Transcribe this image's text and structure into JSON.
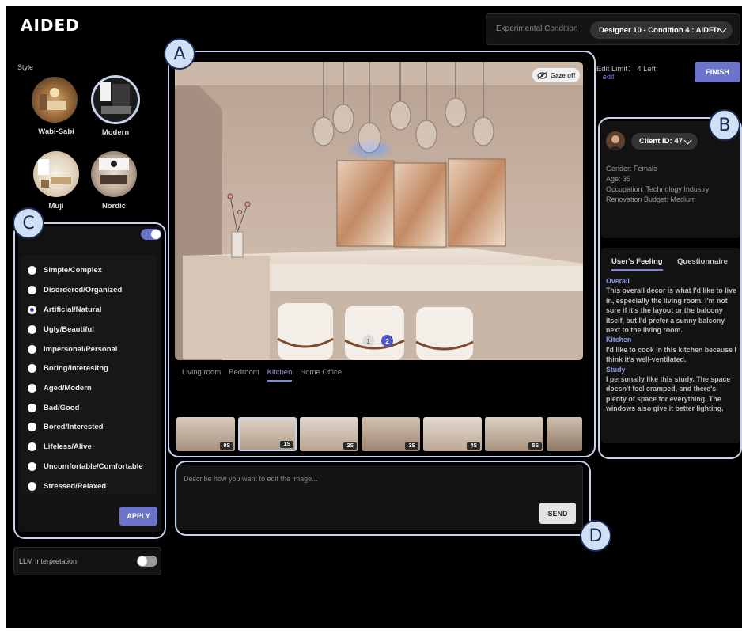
{
  "app": {
    "title": "AIDED"
  },
  "experiment": {
    "label": "Experimental Condition",
    "selected": "Designer 10 - Condition 4 : AIDED"
  },
  "styles": {
    "label": "Style",
    "items": [
      {
        "name": "Wabi-Sabi"
      },
      {
        "name": "Modern"
      },
      {
        "name": "Muji"
      },
      {
        "name": "Nordic"
      }
    ]
  },
  "criteria": {
    "items": [
      "Simple/Complex",
      "Disordered/Organized",
      "Artificial/Natural",
      "Ugly/Beautiful",
      "Impersonal/Personal",
      "Boring/Interesitng",
      "Aged/Modern",
      "Bad/Good",
      "Bored/Interested",
      "Lifeless/Alive",
      "Uncomfortable/Comfortable",
      "Stressed/Relaxed"
    ],
    "apply_label": "APPLY"
  },
  "llm": {
    "label": "LLM Interpretation"
  },
  "viewer": {
    "gaze_label": "Gaze off",
    "pages": [
      "1",
      "2"
    ],
    "room_tabs": [
      "Living room",
      "Bedroom",
      "Kitchen",
      "Home Office"
    ],
    "thumbnails": [
      "0S",
      "1S",
      "2S",
      "3S",
      "4S",
      "5S"
    ]
  },
  "prompt": {
    "placeholder": "Describe how you want to edit the image...",
    "send_label": "SEND"
  },
  "edit": {
    "limit_text": "Edit Limit： 4 Left",
    "edit_link": "edit",
    "finish_label": "FINISH"
  },
  "client": {
    "id_label": "Client ID: 47",
    "gender": "Gender: Female",
    "age": "Age: 35",
    "occupation": "Occupation: Technology Industry",
    "budget": "Renovation Budget: Medium"
  },
  "feeling": {
    "tabs": [
      "User's Feeling",
      "Questionnaire"
    ],
    "sections": [
      {
        "heading": "Overall",
        "text": "This overall decor is what I'd like to live in, especially the living room. I'm not sure if it's the layout or the balcony itself, but I'd prefer a sunny balcony next to the living room."
      },
      {
        "heading": "Kitchen",
        "text": "I'd like to cook in this kitchen because I think it's well-ventilated."
      },
      {
        "heading": "Study",
        "text": "I personally like this study. The space doesn't feel cramped, and there's plenty of space for everything. The windows also give it better lighting."
      }
    ]
  },
  "annotations": {
    "a": "A",
    "b": "B",
    "c": "C",
    "d": "D"
  },
  "colors": {
    "accent": "#6b74c9",
    "highlight": "#8f97e6",
    "ring": "#c9d3ee"
  }
}
